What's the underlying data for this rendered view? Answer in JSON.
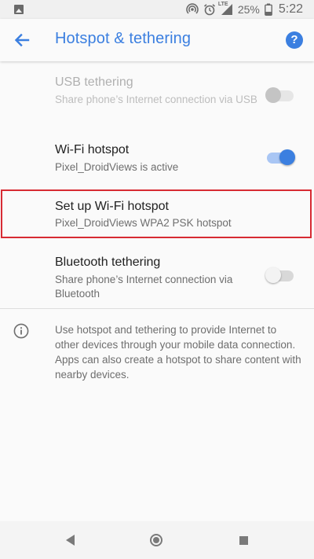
{
  "status_bar": {
    "network_label": "LTE",
    "battery_percent": "25%",
    "time": "5:22",
    "icons": [
      "gallery-icon",
      "hotspot-icon",
      "alarm-icon",
      "signal-icon",
      "battery-icon"
    ]
  },
  "app_bar": {
    "title": "Hotspot & tethering",
    "back_icon": "arrow-back-icon",
    "help_icon": "help-icon",
    "help_glyph": "?"
  },
  "settings": {
    "usb_tethering": {
      "title": "USB tethering",
      "summary": "Share phone’s Internet connection via USB",
      "enabled": false,
      "toggle_on": false
    },
    "wifi_hotspot": {
      "title": "Wi-Fi hotspot",
      "summary": "Pixel_DroidViews is active",
      "toggle_on": true
    },
    "setup_wifi_hotspot": {
      "title": "Set up Wi-Fi hotspot",
      "summary": "Pixel_DroidViews WPA2 PSK hotspot"
    },
    "bluetooth_tethering": {
      "title": "Bluetooth tethering",
      "summary": "Share phone’s Internet connection via Bluetooth",
      "toggle_on": false
    }
  },
  "info": {
    "icon": "info-icon",
    "text": "Use hotspot and tethering to provide Internet to other devices through your mobile data connection. Apps can also create a hotspot to share content with nearby devices."
  },
  "colors": {
    "accent": "#3b7fe0",
    "highlight_border": "#d72b33",
    "background": "#fafafa"
  }
}
